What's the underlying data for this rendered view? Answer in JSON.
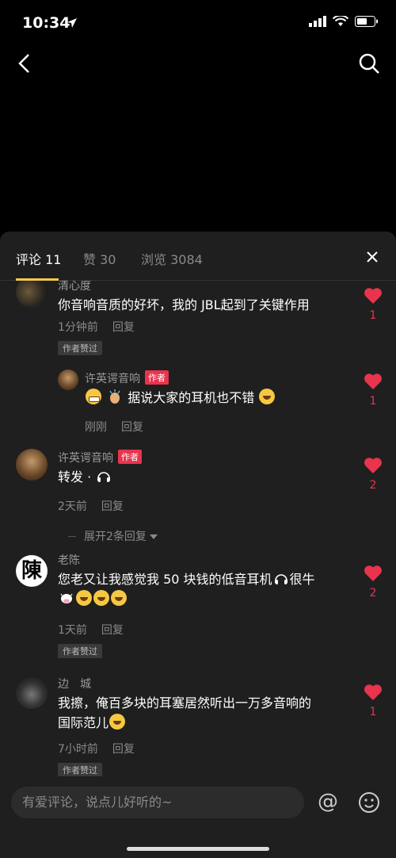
{
  "status": {
    "time": "10:34"
  },
  "tabs": [
    {
      "label": "评论 11"
    },
    {
      "label": "赞 30"
    },
    {
      "label": "浏览 3084"
    }
  ],
  "comments": [
    {
      "name": "清心度",
      "text": "你音响音质的好坏，我的 JBL起到了关键作用",
      "time": "1分钟前",
      "reply": "回复",
      "liked_tag": "作者赞过",
      "likes": "1"
    },
    {
      "name": "许英谔音响",
      "author_tag": "作者",
      "text": "据说大家的耳机也不错",
      "time": "刚刚",
      "reply": "回复",
      "likes": "1"
    },
    {
      "name": "许英谔音响",
      "author_tag": "作者",
      "text": "转发 · ",
      "time": "2天前",
      "reply": "回复",
      "likes": "2",
      "expand": "展开2条回复"
    },
    {
      "name": "老陈",
      "text_line1": "您老又让我感觉我 50 块钱的低音耳机",
      "text_line1_suffix": "很牛",
      "time": "1天前",
      "reply": "回复",
      "liked_tag": "作者赞过",
      "likes": "2",
      "avatar_char": "陳"
    },
    {
      "name": "边　城",
      "text_line1": "我擦，俺百多块的耳塞居然听出一万多音响的",
      "text_line2": "国际范儿",
      "time": "7小时前",
      "reply": "回复",
      "liked_tag": "作者赞过",
      "likes": "1"
    }
  ],
  "input": {
    "placeholder": "有爱评论，说点儿好听的~"
  },
  "at_symbol": "@",
  "colors": {
    "accent": "#f2c94c",
    "like": "#e8344e",
    "sheet_bg": "#1f1f1f"
  }
}
